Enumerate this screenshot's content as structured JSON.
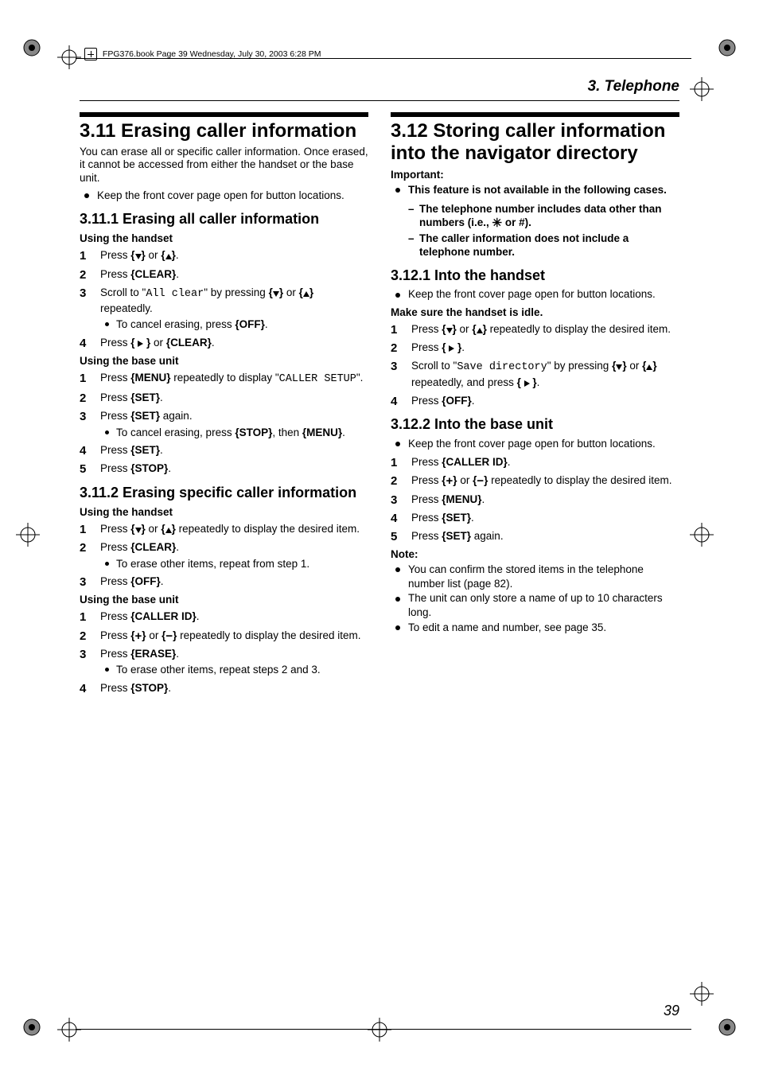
{
  "meta_header": "FPG376.book  Page 39  Wednesday, July 30, 2003  6:28 PM",
  "chapter": "3. Telephone",
  "page_number": "39",
  "left": {
    "h": "3.11 Erasing caller information",
    "intro": "You can erase all or specific caller information. Once erased, it cannot be accessed from either the handset or the base unit.",
    "keep_bullet": "Keep the front cover page open for button locations.",
    "s1_h": "3.11.1 Erasing all caller information",
    "s1_a_head": "Using the handset",
    "s1_a_1a": "Press ",
    "s1_a_1b": " or ",
    "s1_a_1c": ".",
    "s1_a_2a": "Press ",
    "s1_a_2key": "{CLEAR}",
    "s1_a_2b": ".",
    "s1_a_3a": "Scroll to \"",
    "s1_a_3mono": "All clear",
    "s1_a_3b": "\" by pressing ",
    "s1_a_3c": " or ",
    "s1_a_3d": " repeatedly.",
    "s1_a_3sub_a": "To cancel erasing, press ",
    "s1_a_3sub_key": "{OFF}",
    "s1_a_3sub_b": ".",
    "s1_a_4a": "Press ",
    "s1_a_4b": " or ",
    "s1_a_4key": "{CLEAR}",
    "s1_a_4c": ".",
    "s1_b_head": "Using the base unit",
    "s1_b_1a": "Press ",
    "s1_b_1key": "{MENU}",
    "s1_b_1b": " repeatedly to display \"",
    "s1_b_1mono": "CALLER SETUP",
    "s1_b_1c": "\".",
    "s1_b_2a": "Press ",
    "s1_b_2key": "{SET}",
    "s1_b_2b": ".",
    "s1_b_3a": "Press ",
    "s1_b_3key": "{SET}",
    "s1_b_3b": " again.",
    "s1_b_3sub_a": "To cancel erasing, press ",
    "s1_b_3sub_k1": "{STOP}",
    "s1_b_3sub_b": ", then ",
    "s1_b_3sub_k2": "{MENU}",
    "s1_b_3sub_c": ".",
    "s1_b_4a": "Press ",
    "s1_b_4key": "{SET}",
    "s1_b_4b": ".",
    "s1_b_5a": "Press ",
    "s1_b_5key": "{STOP}",
    "s1_b_5b": ".",
    "s2_h": "3.11.2 Erasing specific caller information",
    "s2_a_head": "Using the handset",
    "s2_a_1a": "Press ",
    "s2_a_1b": " or ",
    "s2_a_1c": " repeatedly to display the desired item.",
    "s2_a_2a": "Press ",
    "s2_a_2key": "{CLEAR}",
    "s2_a_2b": ".",
    "s2_a_2sub": "To erase other items, repeat from step 1.",
    "s2_a_3a": "Press ",
    "s2_a_3key": "{OFF}",
    "s2_a_3b": ".",
    "s2_b_head": "Using the base unit",
    "s2_b_1a": "Press ",
    "s2_b_1key": "{CALLER ID}",
    "s2_b_1b": ".",
    "s2_b_2a": "Press ",
    "s2_b_2b": " or ",
    "s2_b_2c": " repeatedly to display the desired item.",
    "s2_b_3a": "Press ",
    "s2_b_3key": "{ERASE}",
    "s2_b_3b": ".",
    "s2_b_3sub": "To erase other items, repeat steps 2 and 3.",
    "s2_b_4a": "Press ",
    "s2_b_4key": "{STOP}",
    "s2_b_4b": "."
  },
  "right": {
    "h": "3.12 Storing caller information into the navigator directory",
    "imp_head": "Important:",
    "imp_bullet": "This feature is not available in the following cases.",
    "imp_d1a": "The telephone number includes data other than numbers (i.e., ",
    "imp_d1b": " or #).",
    "imp_d2": "The caller information does not include a telephone number.",
    "s1_h": "3.12.1 Into the handset",
    "s1_keep": "Keep the front cover page open for button locations.",
    "s1_pre": "Make sure the handset is idle.",
    "s1_1a": "Press ",
    "s1_1b": " or ",
    "s1_1c": " repeatedly to display the desired item.",
    "s1_2a": "Press ",
    "s1_2b": ".",
    "s1_3a": "Scroll to \"",
    "s1_3mono": "Save directory",
    "s1_3b": "\" by pressing ",
    "s1_3c": " or ",
    "s1_3d": " repeatedly, and press ",
    "s1_3e": ".",
    "s1_4a": "Press ",
    "s1_4key": "{OFF}",
    "s1_4b": ".",
    "s2_h": "3.12.2 Into the base unit",
    "s2_keep": "Keep the front cover page open for button locations.",
    "s2_1a": "Press ",
    "s2_1key": "{CALLER ID}",
    "s2_1b": ".",
    "s2_2a": "Press ",
    "s2_2b": " or ",
    "s2_2c": " repeatedly to display the desired item.",
    "s2_3a": "Press ",
    "s2_3key": "{MENU}",
    "s2_3b": ".",
    "s2_4a": "Press ",
    "s2_4key": "{SET}",
    "s2_4b": ".",
    "s2_5a": "Press ",
    "s2_5key": "{SET}",
    "s2_5b": " again.",
    "note_head": "Note:",
    "note_1": "You can confirm the stored items in the telephone number list (page 82).",
    "note_2": "The unit can only store a name of up to 10 characters long.",
    "note_3": "To edit a name and number, see page 35."
  }
}
